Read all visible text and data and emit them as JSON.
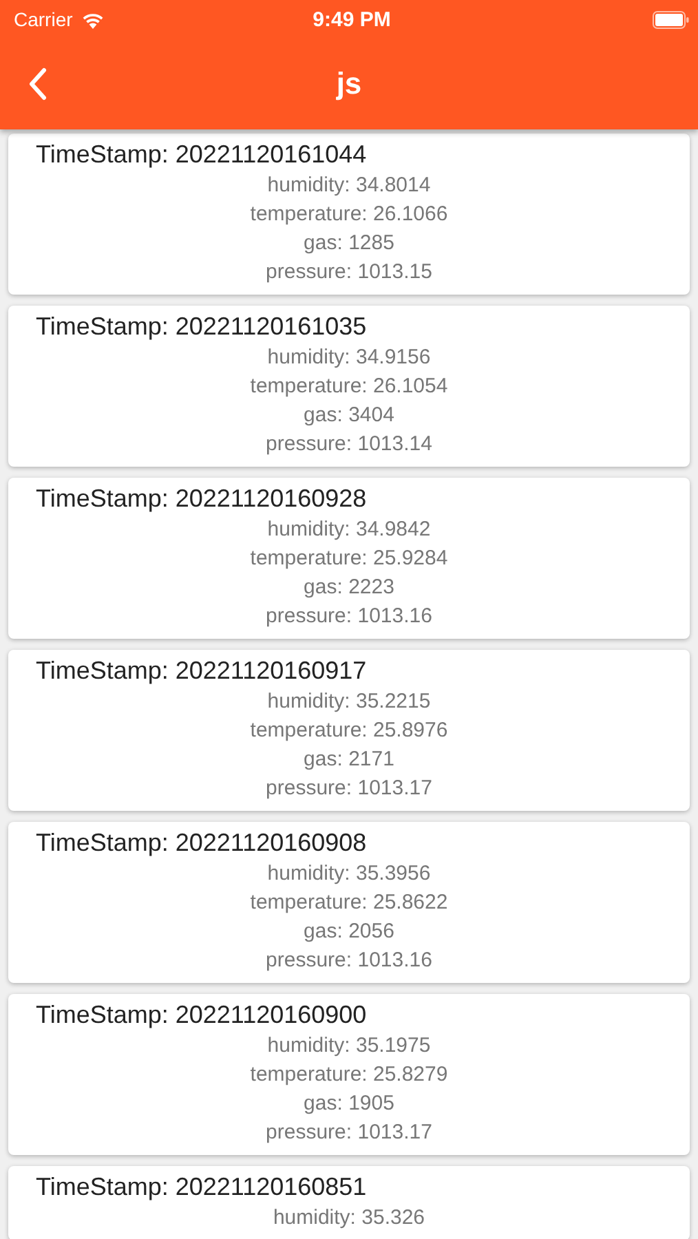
{
  "status_bar": {
    "carrier": "Carrier",
    "time": "9:49 PM"
  },
  "nav_bar": {
    "title": "js"
  },
  "records": [
    {
      "timestamp": "TimeStamp: 20221120161044",
      "fields": [
        "humidity: 34.8014",
        "temperature: 26.1066",
        "gas: 1285",
        "pressure: 1013.15"
      ]
    },
    {
      "timestamp": "TimeStamp: 20221120161035",
      "fields": [
        "humidity: 34.9156",
        "temperature: 26.1054",
        "gas: 3404",
        "pressure: 1013.14"
      ]
    },
    {
      "timestamp": "TimeStamp: 20221120160928",
      "fields": [
        "humidity: 34.9842",
        "temperature: 25.9284",
        "gas: 2223",
        "pressure: 1013.16"
      ]
    },
    {
      "timestamp": "TimeStamp: 20221120160917",
      "fields": [
        "humidity: 35.2215",
        "temperature: 25.8976",
        "gas: 2171",
        "pressure: 1013.17"
      ]
    },
    {
      "timestamp": "TimeStamp: 20221120160908",
      "fields": [
        "humidity: 35.3956",
        "temperature: 25.8622",
        "gas: 2056",
        "pressure: 1013.16"
      ]
    },
    {
      "timestamp": "TimeStamp: 20221120160900",
      "fields": [
        "humidity: 35.1975",
        "temperature: 25.8279",
        "gas: 1905",
        "pressure: 1013.17"
      ]
    },
    {
      "timestamp": "TimeStamp: 20221120160851",
      "fields": [
        "humidity: 35.326"
      ]
    }
  ]
}
